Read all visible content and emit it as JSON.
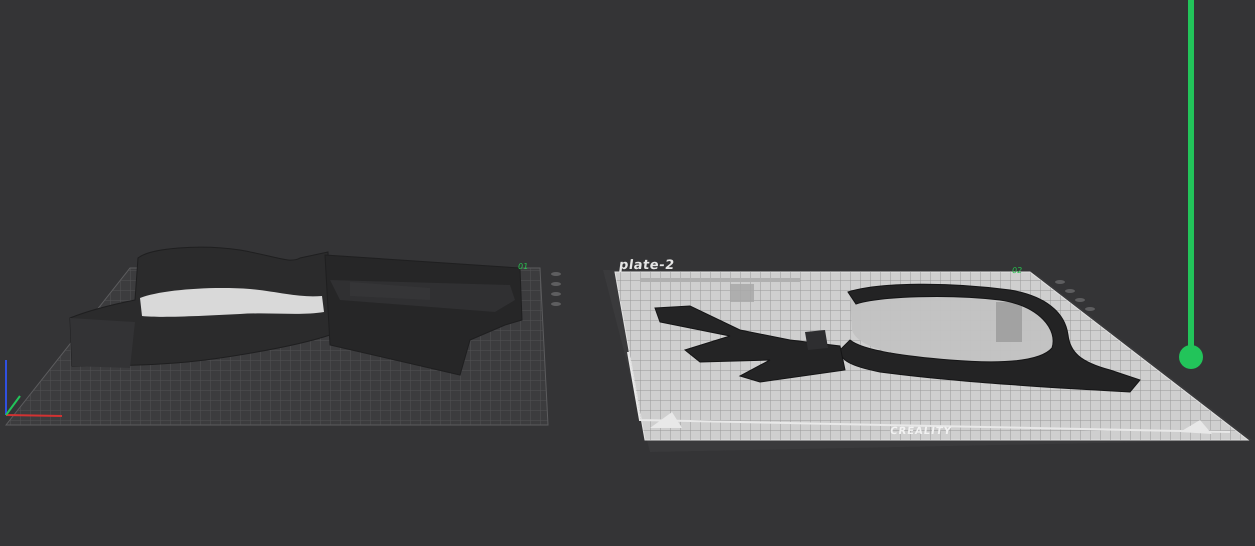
{
  "scene": {
    "background_color": "#343436",
    "plates": [
      {
        "name": "",
        "number": "01"
      },
      {
        "name": "plate-2",
        "number": "02",
        "brand": "CREALITY"
      }
    ],
    "model_color": "#2a2a2b",
    "bed_color": "#c8c8c8"
  },
  "layer_slider": {
    "color": "#22c45a"
  },
  "axes": {
    "x_color": "#d23232",
    "y_color": "#22c45a",
    "z_color": "#3050e0"
  }
}
